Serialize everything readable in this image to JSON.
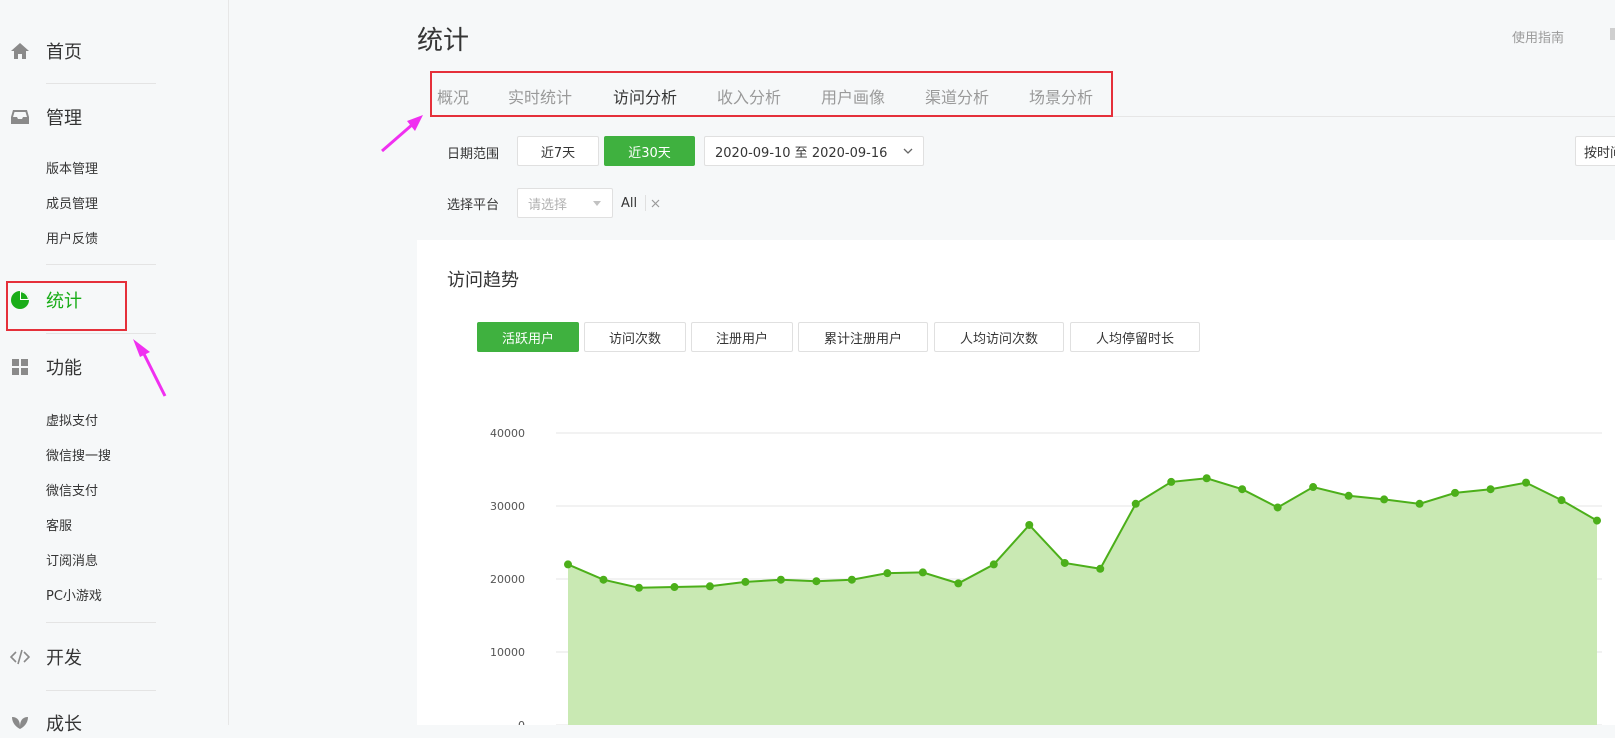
{
  "sidebar": {
    "home": {
      "label": "首页",
      "icon": "home-icon"
    },
    "manage": {
      "label": "管理",
      "icon": "inbox-icon",
      "items": [
        "版本管理",
        "成员管理",
        "用户反馈"
      ]
    },
    "stats": {
      "label": "统计",
      "icon": "pie-chart-icon"
    },
    "features": {
      "label": "功能",
      "icon": "grid-icon",
      "items": [
        "虚拟支付",
        "微信搜一搜",
        "微信支付",
        "客服",
        "订阅消息",
        "PC小游戏"
      ]
    },
    "dev": {
      "label": "开发",
      "icon": "code-icon"
    },
    "growth": {
      "label": "成长",
      "icon": "leaf-icon"
    }
  },
  "header": {
    "title": "统计",
    "guide_link": "使用指南"
  },
  "tabs": [
    "概况",
    "实时统计",
    "访问分析",
    "收入分析",
    "用户画像",
    "渠道分析",
    "场景分析"
  ],
  "active_tab": "访问分析",
  "filters": {
    "date_range_label": "日期范围",
    "btn_7days": "近7天",
    "btn_30days": "近30天",
    "date_value": "2020-09-10 至 2020-09-16",
    "time_select_label": "按时间",
    "platform_label": "选择平台",
    "platform_placeholder": "请选择",
    "platform_tag": "All"
  },
  "trend": {
    "title": "访问趋势",
    "metrics": [
      "活跃用户",
      "访问次数",
      "注册用户",
      "累计注册用户",
      "人均访问次数",
      "人均停留时长"
    ],
    "active_metric": "活跃用户"
  },
  "colors": {
    "accent": "#3fb13f",
    "line": "#4caf1a",
    "area": "#c9e9b3",
    "highlight": "#e5303a",
    "arrow": "#f030f0"
  },
  "chart_data": {
    "type": "area",
    "y_ticks": [
      "40000",
      "30000",
      "20000",
      "10000",
      "0"
    ],
    "ylim": [
      0,
      40000
    ],
    "values": [
      22000,
      19900,
      18800,
      18900,
      19000,
      19600,
      19900,
      19700,
      19900,
      20800,
      20900,
      19400,
      22000,
      27400,
      22200,
      21400,
      30300,
      33300,
      33800,
      32300,
      29800,
      32600,
      31400,
      30900,
      30300,
      31800,
      32300,
      33200,
      30800,
      28000
    ],
    "grid": true
  }
}
